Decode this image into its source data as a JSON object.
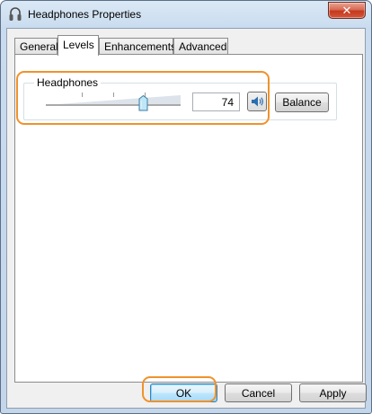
{
  "window": {
    "title": "Headphones Properties",
    "close_symbol": "✕",
    "icon": "headphones-icon"
  },
  "tabs": [
    {
      "label": "General",
      "active": false
    },
    {
      "label": "Levels",
      "active": true
    },
    {
      "label": "Enhancements",
      "active": false
    },
    {
      "label": "Advanced",
      "active": false
    }
  ],
  "levels": {
    "device_label": "Headphones",
    "volume_value": "74",
    "volume_level": 74,
    "mute_icon": "speaker-icon",
    "balance_label": "Balance"
  },
  "buttons": {
    "ok": "OK",
    "cancel": "Cancel",
    "apply": "Apply"
  },
  "colors": {
    "highlight": "#f0922c",
    "default_button_border": "#3c7fb1"
  }
}
